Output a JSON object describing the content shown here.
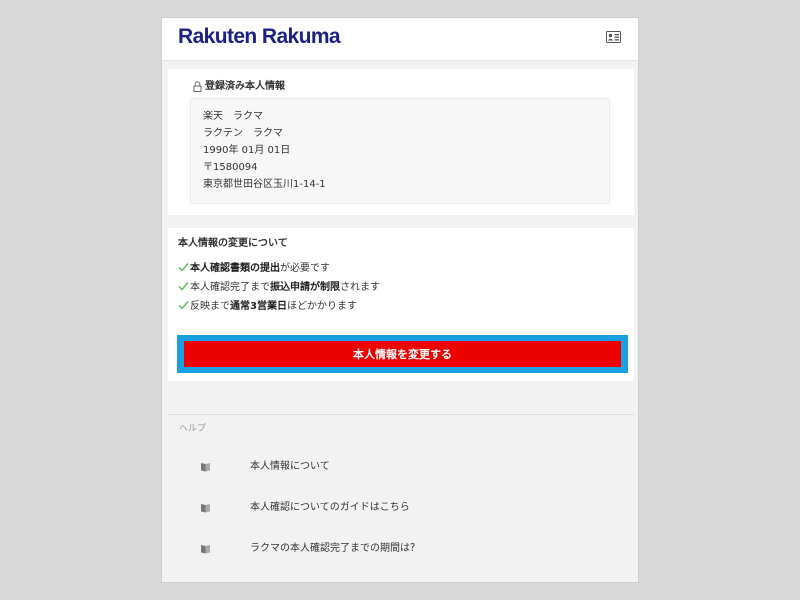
{
  "header": {
    "logo_text": "Rakuten Rakuma",
    "logo_color": "#1d2088",
    "profile_icon": "id-card-icon"
  },
  "registered_info": {
    "title": "登録済み本人情報",
    "title_icon": "lock-icon",
    "lines": [
      "楽天　ラクマ",
      "ラクテン　ラクマ",
      "1990年 01月 01日",
      "〒1580094",
      "東京都世田谷区玉川1-14-1"
    ]
  },
  "change_section": {
    "title": "本人情報の変更について",
    "notes": [
      {
        "bold": "本人確認書類の提出",
        "pre": "",
        "post": "が必要です"
      },
      {
        "pre": "本人確認完了まで",
        "bold": "振込申請が制限",
        "post": "されます"
      },
      {
        "pre": "反映まで",
        "bold": "通常3営業日",
        "post": "ほどかかります"
      }
    ],
    "check_color": "#5cb85c",
    "button_label": "本人情報を変更する",
    "button_color": "#ee0000",
    "focus_ring_color": "#1aa0e0"
  },
  "help": {
    "label": "ヘルプ",
    "items": [
      {
        "label": "本人情報について",
        "icon": "book-icon"
      },
      {
        "label": "本人確認についてのガイドはこちら",
        "icon": "book-icon"
      },
      {
        "label": "ラクマの本人確認完了までの期間は？",
        "icon": "book-icon"
      }
    ]
  }
}
